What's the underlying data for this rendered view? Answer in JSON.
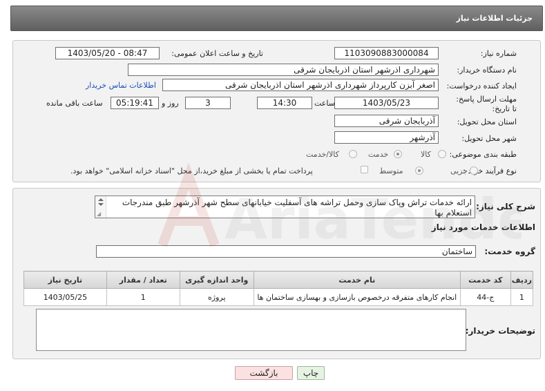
{
  "header": {
    "title": "جزئیات اطلاعات نیاز"
  },
  "form": {
    "need_number_label": "شماره نیاز:",
    "need_number": "1103090883000084",
    "announce_label": "تاریخ و ساعت اعلان عمومی:",
    "announce_value": "1403/05/20 - 08:47",
    "buyer_org_label": "نام دستگاه خریدار:",
    "buyer_org": "شهرداری اذرشهر استان اذربایجان شرقی",
    "requester_label": "ایجاد کننده درخواست:",
    "requester": "اصغر آبزن کارپرداز شهرداری اذرشهر استان اذربایجان شرقی",
    "contact_link": "اطلاعات تماس خریدار",
    "deadline_label": "مهلت ارسال پاسخ: تا تاریخ:",
    "deadline_date": "1403/05/23",
    "time_label": "ساعت",
    "deadline_time": "14:30",
    "days_value": "3",
    "days_label": "روز و",
    "remaining_time": "05:19:41",
    "remaining_label": "ساعت باقی مانده",
    "province_label": "استان محل تحویل:",
    "province": "آذربایجان شرقی",
    "city_label": "شهر محل تحویل:",
    "city": "آذرشهر",
    "category_label": "طبقه بندی موضوعی:",
    "category_options": [
      "کالا",
      "خدمت",
      "کالا/خدمت"
    ],
    "category_selected": "خدمت",
    "purchase_type_label": "نوع فرآیند خرید :",
    "purchase_options": [
      "جزیی",
      "متوسط"
    ],
    "purchase_selected": "متوسط",
    "treasury_note": "پرداخت تمام یا بخشی از مبلغ خرید،از محل \"اسناد خزانه اسلامی\" خواهد بود."
  },
  "summary": {
    "label": "شرح کلی نیاز:",
    "text": "ارائه خدمات تراش وپاک سازی وحمل تراشه های آسفلیت خیابانهای سطح شهر آذرشهر طبق مندرجات استعلام بها"
  },
  "services": {
    "section_title": "اطلاعات خدمات مورد نیاز",
    "group_label": "گروه خدمت:",
    "group_value": "ساختمان",
    "columns": [
      "ردیف",
      "کد خدمت",
      "نام خدمت",
      "واحد اندازه گیری",
      "تعداد / مقدار",
      "تاریخ نیاز"
    ],
    "rows": [
      [
        "1",
        "ج-44",
        "انجام کارهای متفرقه درخصوص بازسازی و بهسازی ساختمان ها",
        "پروژه",
        "1",
        "1403/05/25"
      ]
    ]
  },
  "buyer_notes": {
    "label": "توضیحات خریدار:",
    "value": ""
  },
  "buttons": {
    "print": "چاپ",
    "back": "بازگشت"
  },
  "watermark": {
    "text": "AriaTender.net"
  }
}
